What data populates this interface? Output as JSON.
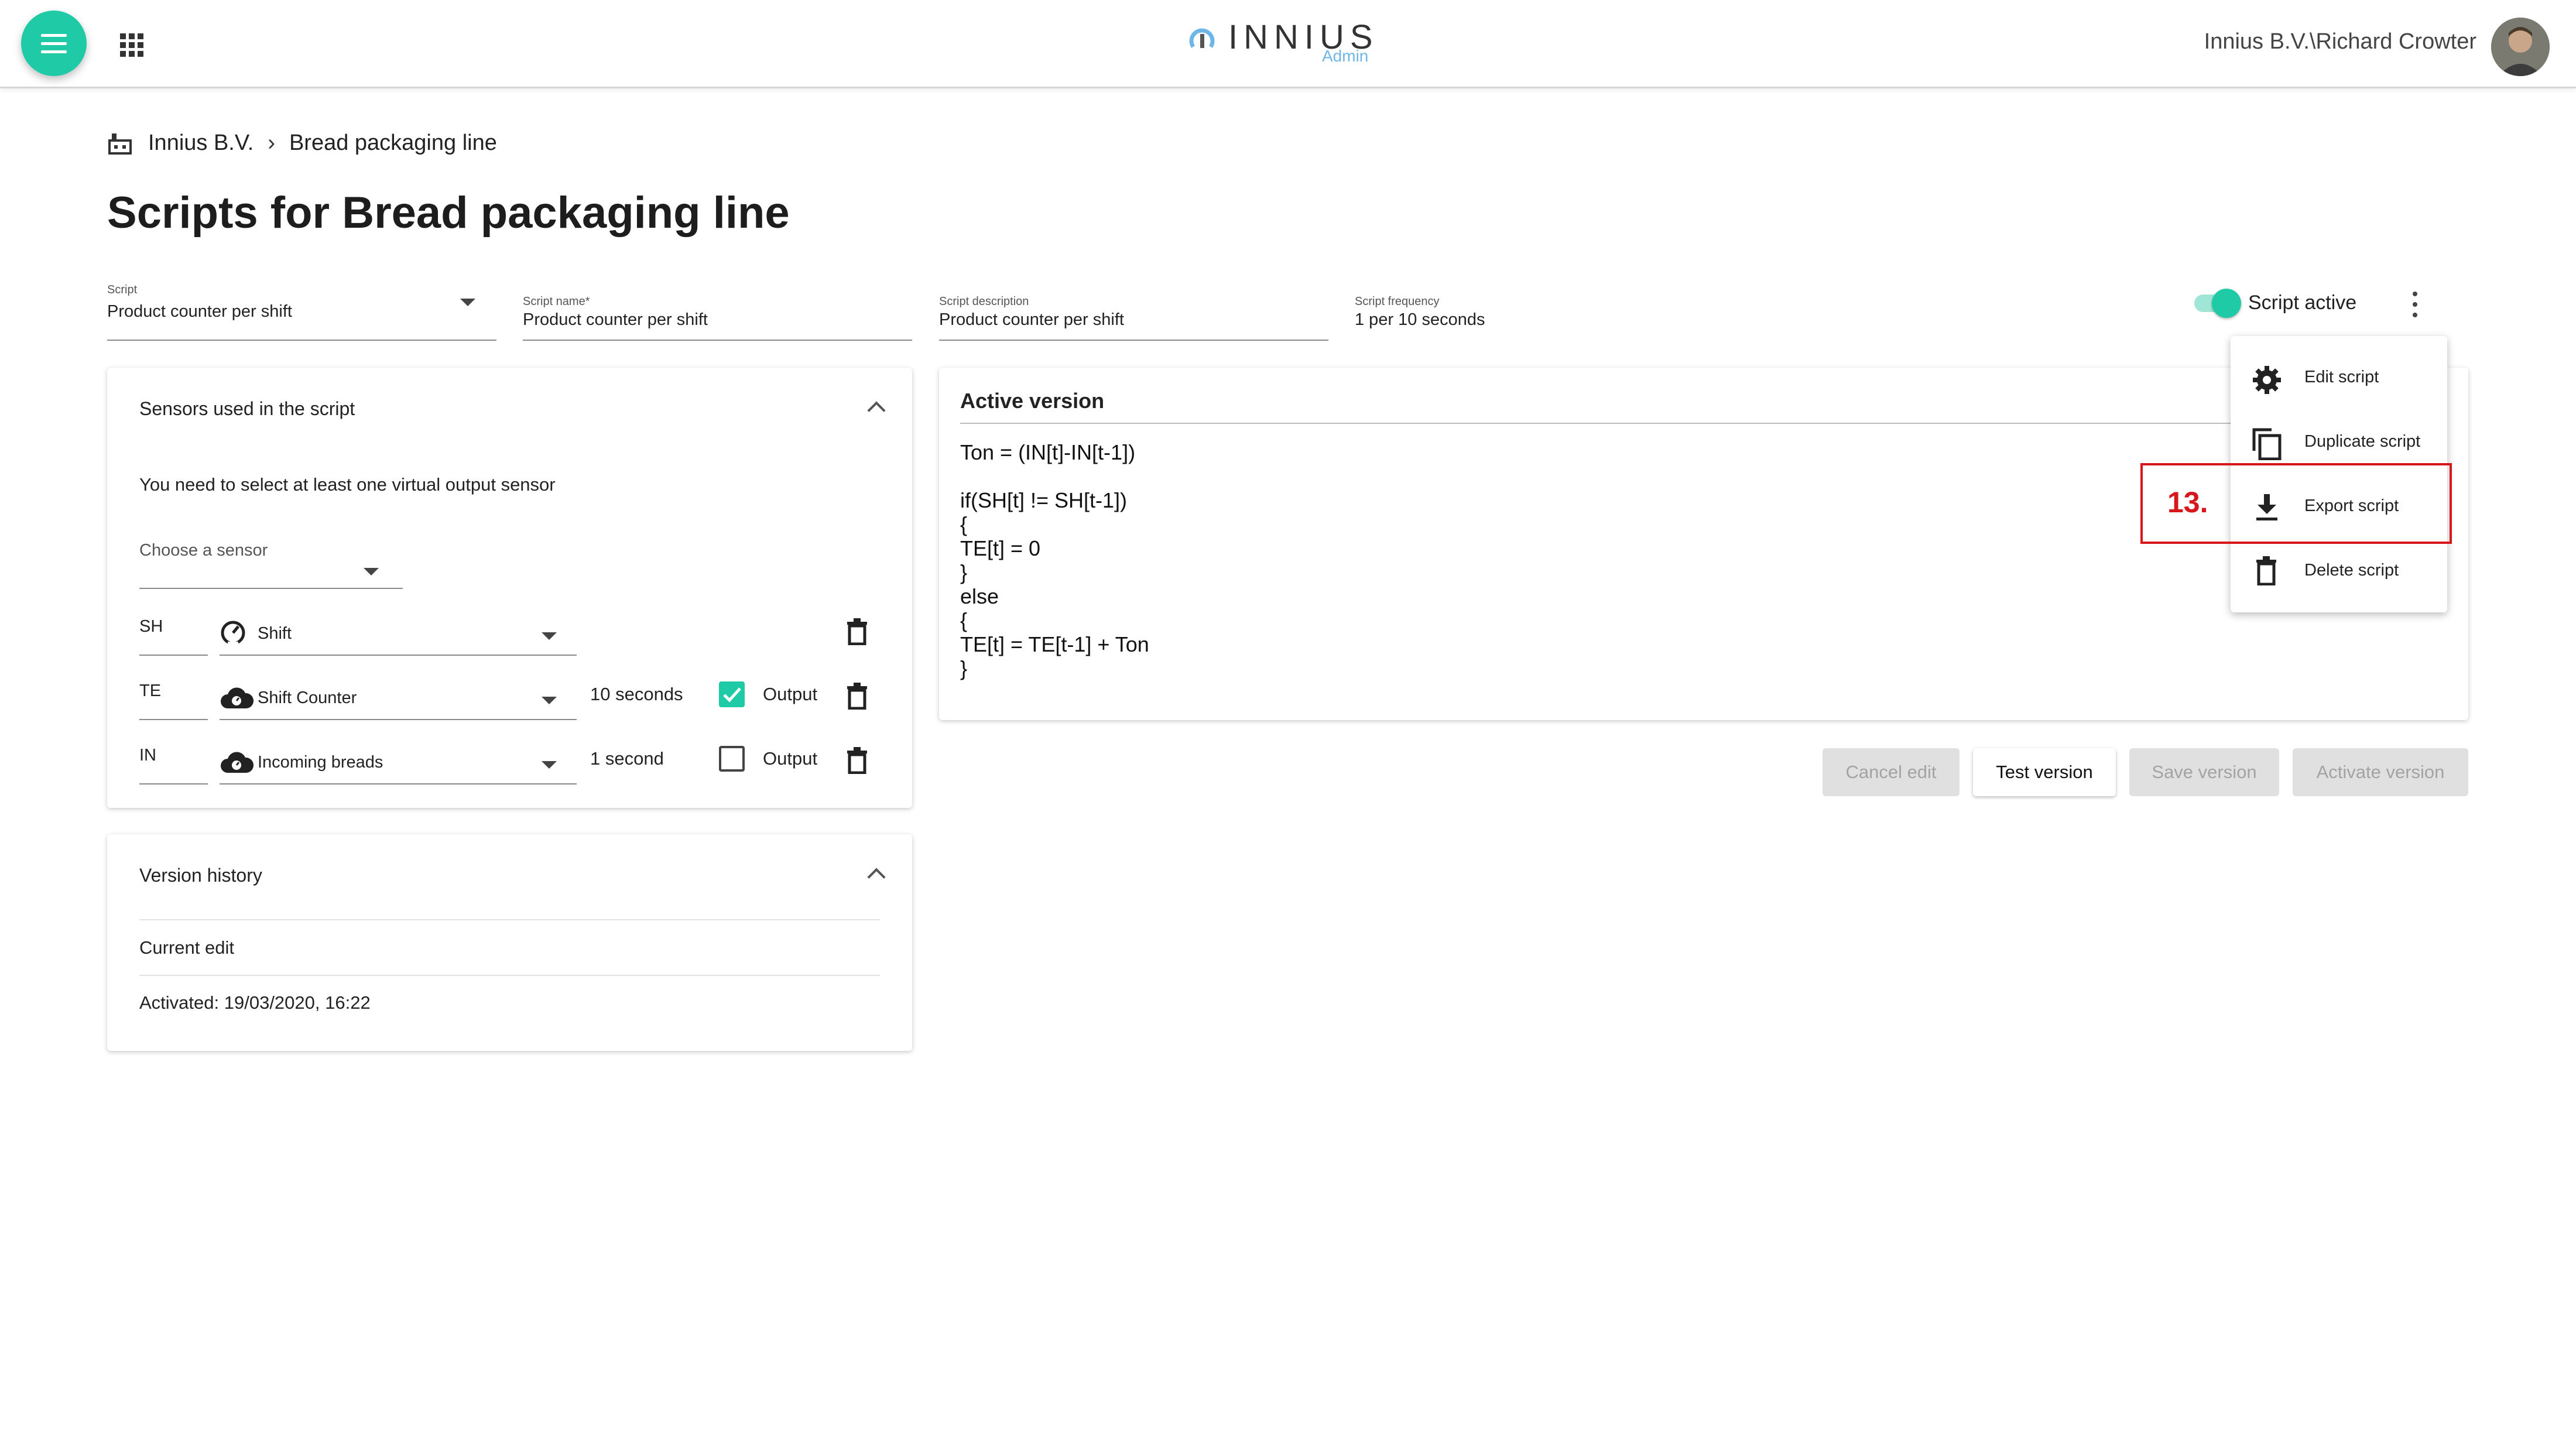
{
  "header": {
    "logo_text": "INNIUS",
    "logo_sub": "Admin",
    "user_name": "Innius B.V.\\Richard Crowter"
  },
  "breadcrumb": {
    "org": "Innius B.V.",
    "current": "Bread packaging line"
  },
  "page_title": "Scripts for Bread packaging line",
  "form": {
    "script": {
      "label": "Script",
      "value": "Product counter per shift"
    },
    "name": {
      "label": "Script name*",
      "value": "Product counter per shift"
    },
    "description": {
      "label": "Script description",
      "value": "Product counter per shift"
    },
    "frequency": {
      "label": "Script frequency",
      "value": "1 per 10 seconds"
    },
    "toggle_label": "Script active",
    "toggle_on": true
  },
  "sensors_card": {
    "title": "Sensors used in the script",
    "notice": "You need to select at least one virtual output sensor",
    "choose_label": "Choose a sensor",
    "rows": [
      {
        "code": "SH",
        "name": "Shift",
        "interval": "",
        "output_label": "",
        "output_checked": false
      },
      {
        "code": "TE",
        "name": "Shift Counter",
        "interval": "10 seconds",
        "output_label": "Output",
        "output_checked": true
      },
      {
        "code": "IN",
        "name": "Incoming breads",
        "interval": "1 second",
        "output_label": "Output",
        "output_checked": false
      }
    ]
  },
  "history_card": {
    "title": "Version history",
    "current": "Current edit",
    "activated": "Activated: 19/03/2020, 16:22"
  },
  "active_version": {
    "title": "Active version",
    "code_lines": [
      "Ton = (IN[t]-IN[t-1])",
      "",
      "if(SH[t] != SH[t-1])",
      "{",
      "TE[t] = 0",
      "}",
      "else",
      "{",
      "TE[t] = TE[t-1] + Ton",
      "}"
    ]
  },
  "buttons": {
    "cancel": "Cancel edit",
    "test": "Test version",
    "save": "Save version",
    "activate": "Activate version"
  },
  "menu": {
    "items": [
      {
        "label": "Edit script",
        "icon": "gear-icon"
      },
      {
        "label": "Duplicate script",
        "icon": "copy-icon"
      },
      {
        "label": "Export script",
        "icon": "download-icon"
      },
      {
        "label": "Delete script",
        "icon": "trash-icon"
      }
    ]
  },
  "annotation": {
    "step": "13."
  },
  "colors": {
    "accent": "#1fcaa6",
    "annotation": "#d6171c",
    "logo_sub": "#6fb6e8"
  }
}
